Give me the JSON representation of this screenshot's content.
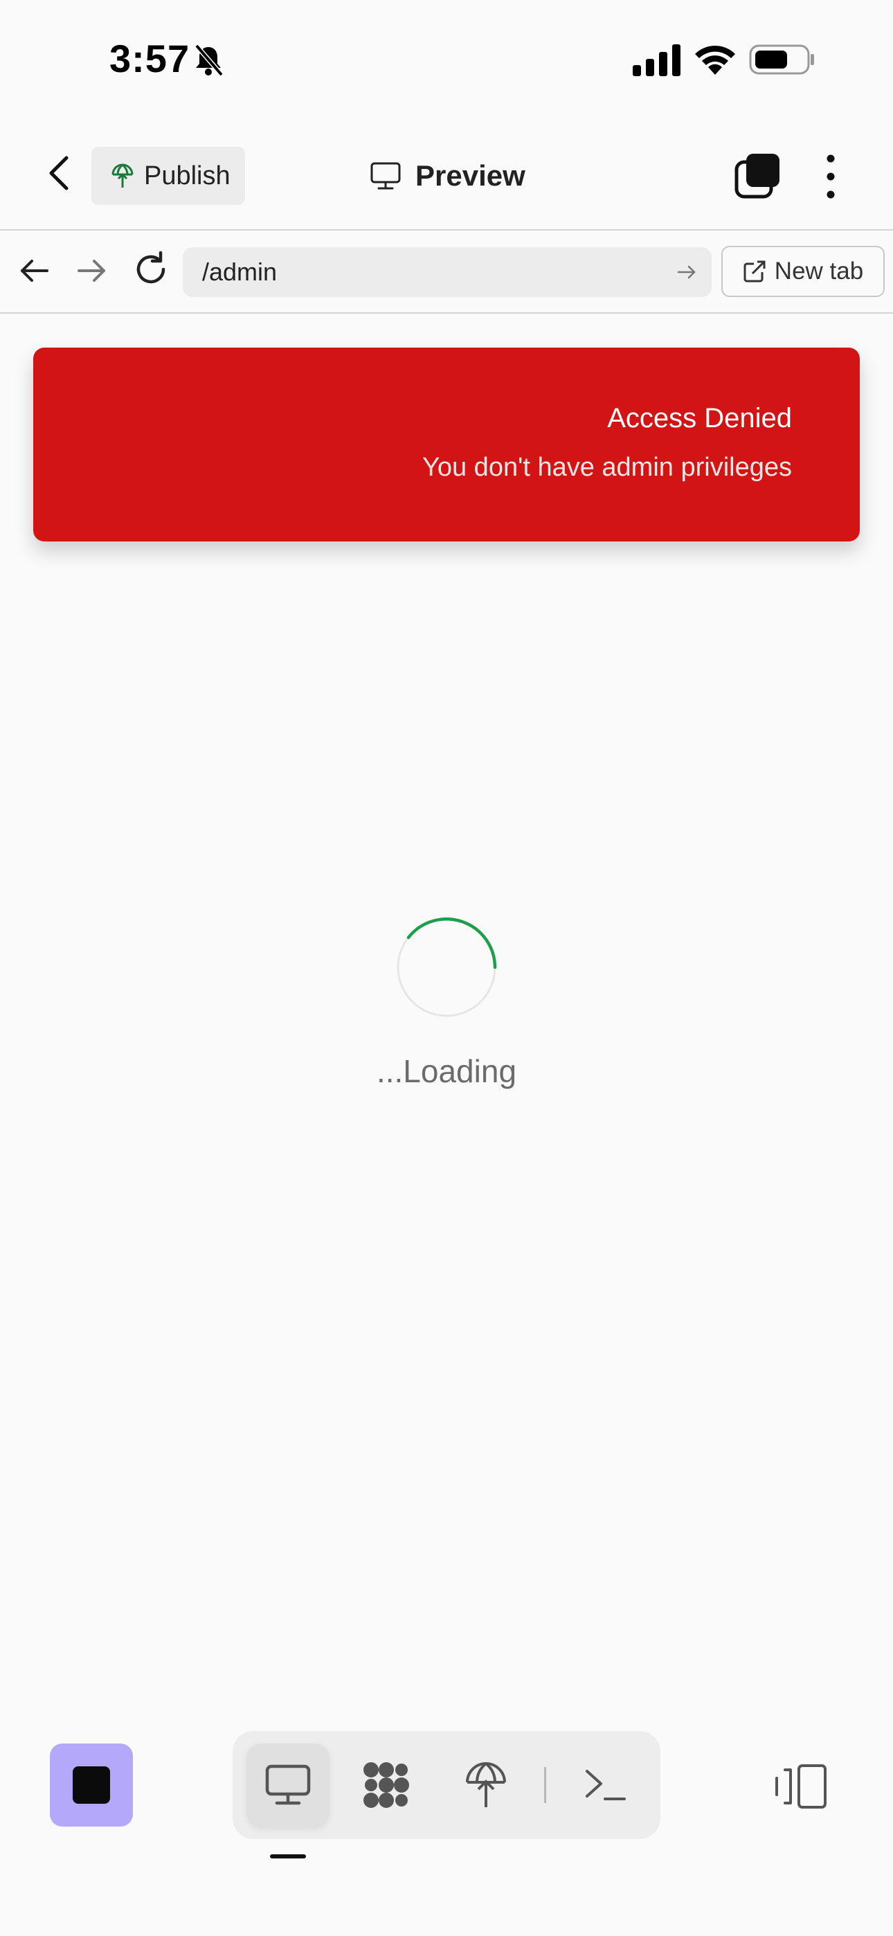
{
  "status_bar": {
    "time": "3:57",
    "icons": [
      "bell-slash-icon",
      "cellular-signal-icon",
      "wifi-icon",
      "battery-icon"
    ]
  },
  "app_bar": {
    "publish_label": "Publish",
    "title": "Preview",
    "icons": [
      "chevron-left-icon",
      "globe-upload-icon",
      "monitor-icon",
      "tabs-icon",
      "more-vertical-icon"
    ]
  },
  "nav_bar": {
    "url": "/admin",
    "new_tab_label": "New tab",
    "icons": [
      "arrow-left-icon",
      "arrow-right-icon",
      "reload-icon",
      "go-arrow-icon",
      "external-link-icon"
    ]
  },
  "toast": {
    "title": "Access Denied",
    "message": "You don't have admin privileges",
    "color": "#d31414"
  },
  "content": {
    "loading_text": "...Loading",
    "spinner_color": "#1e9e4a"
  },
  "bottom_bar": {
    "stop_button_color": "#b4a8fa",
    "tools": [
      "monitor-icon",
      "integrations-icon",
      "publish-icon",
      "terminal-icon"
    ],
    "active_tool": "monitor-icon",
    "layout_icon": "split-view-icon"
  }
}
